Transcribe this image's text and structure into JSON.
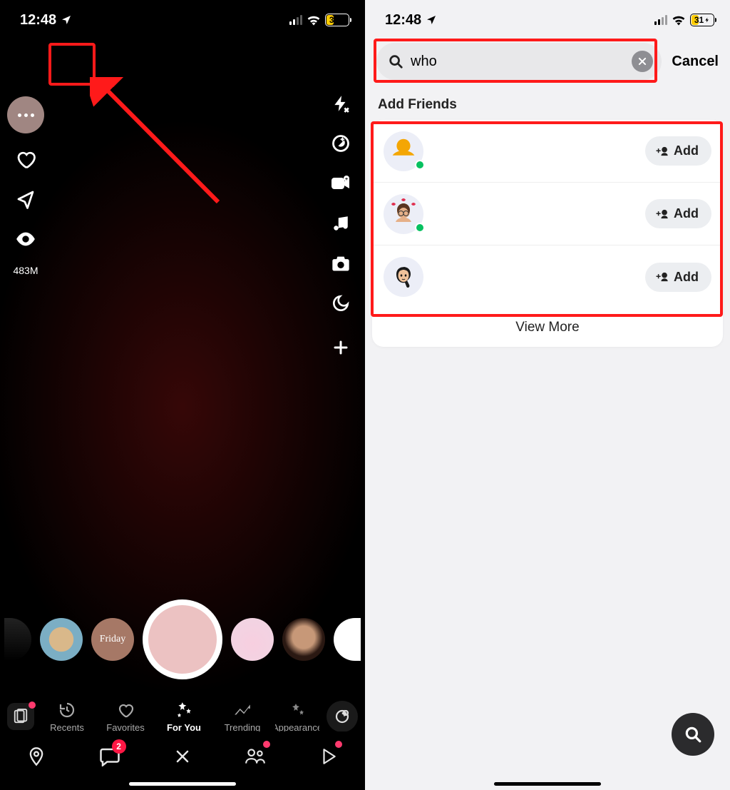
{
  "status": {
    "time": "12:48",
    "battery_percent": "31",
    "battery_fill_pct": 31
  },
  "left": {
    "view_count": "483M",
    "tabs": [
      {
        "label": "Recents"
      },
      {
        "label": "Favorites"
      },
      {
        "label": "For You"
      },
      {
        "label": "Trending"
      },
      {
        "label": "Appearance"
      }
    ],
    "chat_badge": "2"
  },
  "right": {
    "search_value": "who",
    "cancel_label": "Cancel",
    "section_title": "Add Friends",
    "add_label": "Add",
    "view_more_label": "View More",
    "friends": [
      {
        "online": true,
        "avatar_kind": "yellow"
      },
      {
        "online": true,
        "avatar_kind": "male-hearts"
      },
      {
        "online": false,
        "avatar_kind": "female-dark"
      }
    ]
  },
  "annotations": {
    "highlight_color": "#ff1a1a"
  }
}
